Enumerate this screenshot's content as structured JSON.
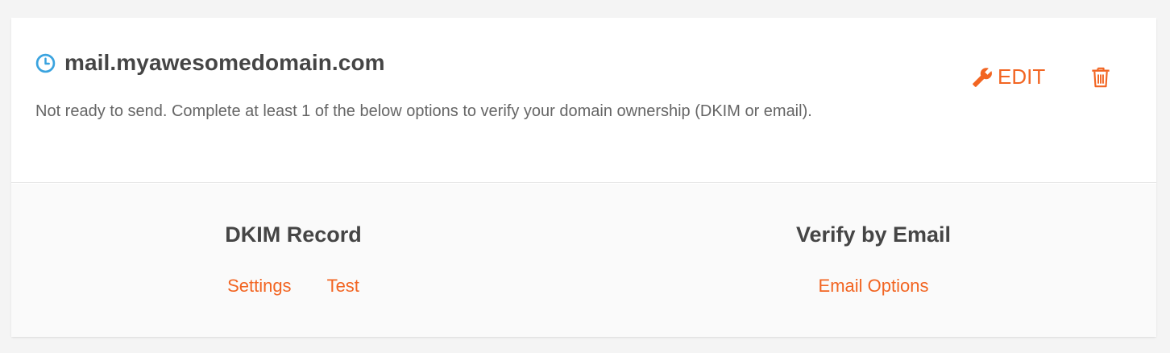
{
  "domain": {
    "name": "mail.myawesomedomain.com",
    "status_message": "Not ready to send. Complete at least 1 of the below options to verify your domain ownership (DKIM or email).",
    "status_icon": "clock-icon",
    "status_icon_color": "#3aa3df"
  },
  "actions": {
    "edit_label": "EDIT",
    "edit_icon": "wrench-icon",
    "delete_icon": "trash-icon"
  },
  "options": {
    "dkim": {
      "title": "DKIM Record",
      "links": [
        "Settings",
        "Test"
      ]
    },
    "email": {
      "title": "Verify by Email",
      "links": [
        "Email Options"
      ]
    }
  },
  "colors": {
    "accent": "#f26522",
    "title_text": "#454545",
    "body_text": "#666666",
    "status_blue": "#3aa3df"
  }
}
